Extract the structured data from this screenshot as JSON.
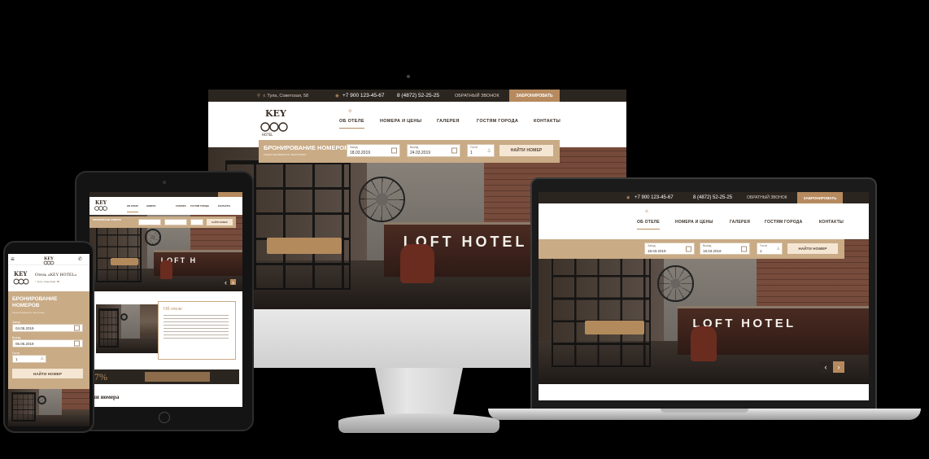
{
  "desktop": {
    "address": "г. Тула, Советская, 58",
    "phone1": "+7 900 123-45-67",
    "phone2": "8 (4872) 52-25-25",
    "callback": "ОБРАТНЫЙ ЗВОНОК",
    "book": "ЗАБРОНИРОВАТЬ",
    "nav": [
      "ОБ ОТЕЛЕ",
      "НОМЕРА И ЦЕНЫ",
      "ГАЛЕРЕЯ",
      "ГОСТЯМ ГОРОДА",
      "КОНТАКТЫ"
    ],
    "booking_title": "БРОНИРОВАНИЕ НОМЕРОВ",
    "booking_sub": "гарантированное заселение",
    "checkin_label": "Заезд",
    "checkin_value": "18.03.2019",
    "checkout_label": "Выезд",
    "checkout_value": "24.03.2019",
    "guests_label": "Гости",
    "guests_value": "1",
    "search_button": "НАЙТИ НОМЕР",
    "scene_text": "LOFT HOTEL"
  },
  "laptop": {
    "phone1": "+7 900 123-45-67",
    "phone2": "8 (4872) 52-25-25",
    "callback": "ОБРАТНЫЙ ЗВОНОК",
    "book": "ЗАБРОНИРОВАТЬ",
    "nav": [
      "ОБ ОТЕЛЕ",
      "НОМЕРА И ЦЕНЫ",
      "ГАЛЕРЕЯ",
      "ГОСТЯМ ГОРОДА",
      "КОНТАКТЫ"
    ],
    "checkin_label": "Заезд",
    "checkin_value": "18.03.2019",
    "checkout_label": "Выезд",
    "checkout_value": "18.03.2019",
    "guests_label": "Гости",
    "guests_value": "1",
    "search_button": "НАЙТИ НОМЕР",
    "scene_text": "LOFT HOTEL"
  },
  "tablet": {
    "nav": [
      "ОБ ОТЕЛЕ",
      "НОМЕРА",
      "ГАЛЕРЕЯ",
      "ГОСТЯМ ГОРОДА",
      "КОНТАКТЫ"
    ],
    "booking_title": "БРОНИРОВАНИЕ НОМЕРОВ",
    "search_button": "НАЙТИ НОМЕР",
    "about_title": "Об отеле",
    "discount": "7%",
    "rooms_heading": "ши номера",
    "scene_text": "LOFT H"
  },
  "phone": {
    "hotel_name": "Отель «KEY HOTEL»",
    "address": "г. Тула, Советская, 58",
    "booking_title": "БРОНИРОВАНИЕ НОМЕРОВ",
    "booking_sub": "Гарантированное заселение",
    "checkin_label": "Заезд",
    "checkin_value": "04.05.2019",
    "checkout_label": "Выезд",
    "checkout_value": "05.05.2019",
    "guests_label": "Гости",
    "guests_value": "1",
    "search_button": "НАЙТИ НОМЕР"
  },
  "colors": {
    "accent": "#b68a5e",
    "booking": "#c9ab86",
    "dark": "#2b2520"
  },
  "icons": [
    "location-icon",
    "whatsapp-icon",
    "calendar-icon",
    "user-icon",
    "chevron-left-icon",
    "chevron-right-icon",
    "menu-icon",
    "phone-icon",
    "key-logo"
  ]
}
